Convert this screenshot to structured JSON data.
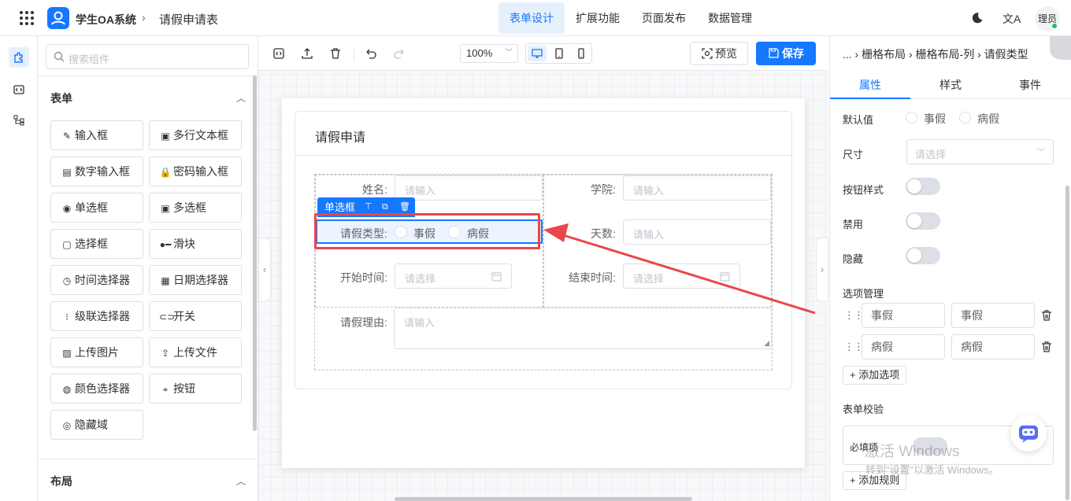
{
  "header": {
    "app_title": "学生OA系统",
    "separator": "›",
    "page_name": "请假申请表",
    "nav": [
      "表单设计",
      "扩展功能",
      "页面发布",
      "数据管理"
    ],
    "active_nav": "表单设计",
    "avatar_text": "理员",
    "lang_glyph": "文A"
  },
  "palette": {
    "search_placeholder": "搜索组件",
    "form_section": "表单",
    "form_items": [
      {
        "icon": "✎",
        "label": "输入框"
      },
      {
        "icon": "▣",
        "label": "多行文本框"
      },
      {
        "icon": "▤",
        "label": "数字输入框"
      },
      {
        "icon": "🔒",
        "label": "密码输入框"
      },
      {
        "icon": "◉",
        "label": "单选框"
      },
      {
        "icon": "▣",
        "label": "多选框"
      },
      {
        "icon": "▢",
        "label": "选择框"
      },
      {
        "icon": "●━",
        "label": "滑块"
      },
      {
        "icon": "◷",
        "label": "时间选择器"
      },
      {
        "icon": "▦",
        "label": "日期选择器"
      },
      {
        "icon": "⁝",
        "label": "级联选择器"
      },
      {
        "icon": "⊂⊃",
        "label": "开关"
      },
      {
        "icon": "▨",
        "label": "上传图片"
      },
      {
        "icon": "⇪",
        "label": "上传文件"
      },
      {
        "icon": "◍",
        "label": "颜色选择器"
      },
      {
        "icon": "⌖",
        "label": "按钮"
      },
      {
        "icon": "◎",
        "label": "隐藏域"
      }
    ],
    "layout_section": "布局"
  },
  "toolbar": {
    "zoom": "100%",
    "preview_label": "预览",
    "save_label": "保存"
  },
  "form": {
    "title": "请假申请",
    "name_label": "姓名:",
    "name_placeholder": "请输入",
    "college_label": "学院:",
    "college_placeholder": "请输入",
    "leave_type_label": "请假类型:",
    "leave_options": [
      "事假",
      "病假"
    ],
    "days_label": "天数:",
    "days_placeholder": "请输入",
    "start_label": "开始时间:",
    "start_placeholder": "请选择",
    "end_label": "结束时间:",
    "end_placeholder": "请选择",
    "reason_label": "请假理由:",
    "reason_placeholder": "请输入",
    "selected_tag": "单选框"
  },
  "props": {
    "breadcrumb": "... › 栅格布局 › 栅格布局-列 › 请假类型",
    "tabs": [
      "属性",
      "样式",
      "事件"
    ],
    "active_tab": "属性",
    "default_label": "默认值",
    "default_options": [
      "事假",
      "病假"
    ],
    "size_label": "尺寸",
    "size_placeholder": "请选择",
    "button_style_label": "按钮样式",
    "disabled_label": "禁用",
    "hidden_label": "隐藏",
    "options_label": "选项管理",
    "options": [
      {
        "label": "事假",
        "value": "事假"
      },
      {
        "label": "病假",
        "value": "病假"
      }
    ],
    "add_option": "+ 添加选项",
    "validation_label": "表单校验",
    "required_label": "必填项",
    "add_rule": "+ 添加规则"
  },
  "watermark": {
    "line1": "激活 Windows",
    "line2": "转到\"设置\"以激活 Windows。"
  },
  "colors": {
    "primary": "#1677ff",
    "annotation": "#e8474b"
  }
}
